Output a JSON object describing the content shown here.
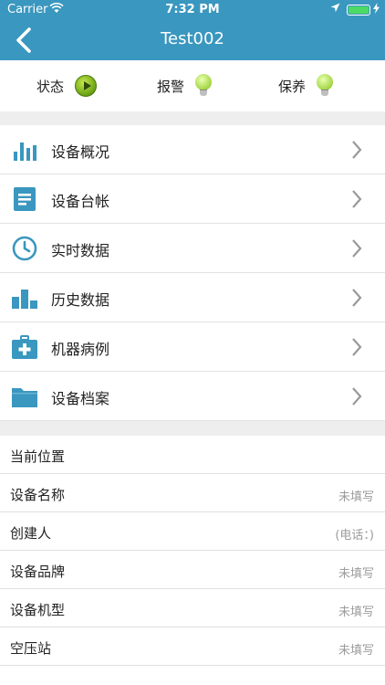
{
  "status_bar": {
    "carrier": "Carrier",
    "time": "7:32 PM"
  },
  "nav": {
    "title": "Test002"
  },
  "status_row": {
    "items": [
      {
        "label": "状态",
        "icon": "play-icon",
        "color": "#7cb518"
      },
      {
        "label": "报警",
        "icon": "bulb-icon",
        "color": "#a6d84a"
      },
      {
        "label": "保养",
        "icon": "bulb-icon",
        "color": "#a6d84a"
      }
    ]
  },
  "menu": {
    "accent_color": "#3a97bf",
    "items": [
      {
        "label": "设备概况",
        "icon": "bar-chart-icon"
      },
      {
        "label": "设备台帐",
        "icon": "document-icon"
      },
      {
        "label": "实时数据",
        "icon": "clock-icon"
      },
      {
        "label": "历史数据",
        "icon": "history-chart-icon"
      },
      {
        "label": "机器病例",
        "icon": "medical-kit-icon"
      },
      {
        "label": "设备档案",
        "icon": "folder-icon"
      }
    ]
  },
  "info": {
    "rows": [
      {
        "label": "当前位置",
        "value": ""
      },
      {
        "label": "设备名称",
        "value": "未填写"
      },
      {
        "label": "创建人",
        "value": "(电话：)"
      },
      {
        "label": "设备品牌",
        "value": "未填写"
      },
      {
        "label": "设备机型",
        "value": "未填写"
      },
      {
        "label": "空压站",
        "value": "未填写"
      }
    ]
  }
}
